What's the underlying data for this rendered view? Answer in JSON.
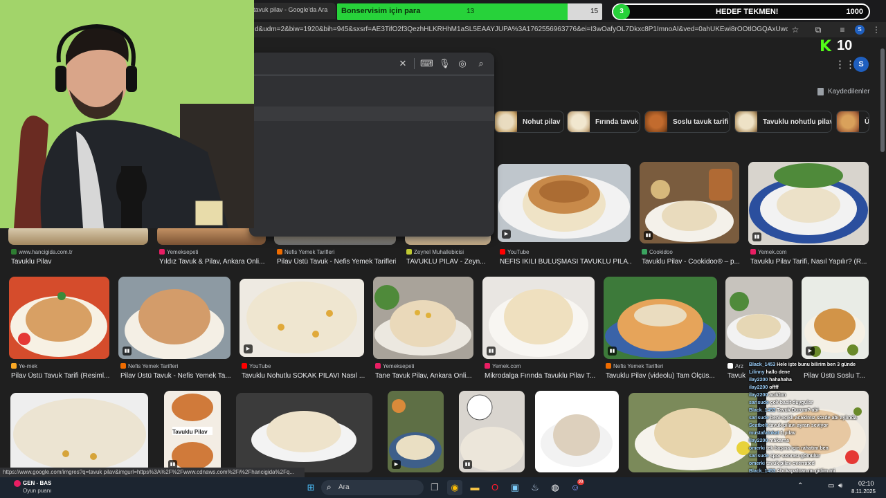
{
  "browser": {
    "tab_title": "tavuk pilav - Google'da Ara",
    "url": "d&udm=2&biw=1920&bih=945&sxsrf=AE3TifO2f3QezhHLKRHhM1aSL5EAAYJUPA%3A1762556963776&ei=I3wOafyOL7Dkxc8P1ImnoAI&ved=0ahUKEwi8rOOtlOGQAxUwcvEDHdTECS...",
    "profile_initial": "S",
    "status_url": "https://www.google.com/imgres?q=tavuk pilav&imgurl=https%3A%2F%2Fwww.cdnaws.com%2Fi%2Fhancigida%2Fq..."
  },
  "overlay": {
    "goal_label": "Bonservisim için para",
    "goal_current": "13",
    "goal_total": "15",
    "goal_progress": 0.87,
    "target_count": "3",
    "target_label": "HEDEF TEKMEN!",
    "target_total": "1000",
    "kick_count": "10"
  },
  "google": {
    "account_initial": "S",
    "saved_label": "Kaydedilenler",
    "chips": [
      {
        "label": "Nohut pilav"
      },
      {
        "label": "Fırında tavuk"
      },
      {
        "label": "Soslu tavuk tarifi"
      },
      {
        "label": "Tavuklu nohutlu pilav"
      },
      {
        "label": "Ü"
      }
    ]
  },
  "results_row1": [
    {
      "source": "www.hancigida.com.tr",
      "title": "Tavuklu Pilav"
    },
    {
      "source": "Yemeksepeti",
      "title": "Yıldız Tavuk & Pilav, Ankara Onli..."
    },
    {
      "source": "Nefis Yemek Tarifleri",
      "title": "Pilav Üstü Tavuk - Nefis Yemek Tarifleri"
    },
    {
      "source": "Zeynel Muhallebicisi",
      "title": "TAVUKLU PİLAV - Zeyn..."
    },
    {
      "source": "YouTube",
      "title": "NEFİS İKİLİ BULUŞMASI TAVUKLU PİLA..."
    },
    {
      "source": "Cookidoo",
      "title": "Tavuklu Pilav - Cookidoo® – p..."
    },
    {
      "source": "Yemek.com",
      "title": "Tavuklu Pilav Tarifi, Nasıl Yapılır? (R..."
    }
  ],
  "results_row2": [
    {
      "source": "Ye-mek",
      "title": "Pilav Üstü Tavuk Tarifi (Resiml..."
    },
    {
      "source": "Nefis Yemek Tarifleri",
      "title": "Pilav Üstü Tavuk - Nefis Yemek Ta..."
    },
    {
      "source": "YouTube",
      "title": "Tavuklu Nohutlu SOKAK PİLAVI Nasıl ..."
    },
    {
      "source": "Yemeksepeti",
      "title": "Tane Tavuk Pilav, Ankara Onli..."
    },
    {
      "source": "Yemek.com",
      "title": "Mikrodalga Fırında Tavuklu Pilav T..."
    },
    {
      "source": "Nefis Yemek Tarifleri",
      "title": "Tavuklu Pilav (videolu) Tam Ölçüs..."
    },
    {
      "source": "Arz",
      "title": "Tavuk"
    },
    {
      "source": "",
      "title": "Pilav Üstü Soslu T..."
    }
  ],
  "row3_caption": "Tavuklu Pilav",
  "chat": [
    {
      "user": "Black_1453",
      "msg": "Hele işte bunu bilirim ben 3 günde"
    },
    {
      "user": "Lilinny",
      "msg": "hallo dene"
    },
    {
      "user": "ilay2200",
      "msg": "hahahaha"
    },
    {
      "user": "ilay2200",
      "msg": "offff"
    },
    {
      "user": "ilay2200",
      "msg": "acıktım"
    },
    {
      "user": "sarisude",
      "msg": "çok basit duygular"
    },
    {
      "user": "Black_1453",
      "msg": "Tavuk Durum? abi"
    },
    {
      "user": "sarisude",
      "msg": "beni açıklı acaklmız sözde abi aylında"
    },
    {
      "user": "Seatbelt",
      "msg": "tavuk pilavı ayran seviyor"
    },
    {
      "user": "mustafatokat",
      "msg": "1 pilav"
    },
    {
      "user": "ilay2200",
      "msg": "makarna"
    },
    {
      "user": "omerki",
      "msg": "tek başına için rahatım ben"
    },
    {
      "user": "sarisude",
      "msg": "spor sonrası gömülür"
    },
    {
      "user": "omerki",
      "msg": "tavuk pilav overrated"
    },
    {
      "user": "Black_1453",
      "msg": "Abi kapatcan mı gidim mi"
    }
  ],
  "taskbar": {
    "widget_title": "GEN - BAS",
    "widget_sub": "Oyun puanı",
    "search_placeholder": "Ara",
    "time": "02:10",
    "date": "8.11.2025",
    "notif_badge": "99"
  },
  "webcam_label": "streamer-webcam"
}
